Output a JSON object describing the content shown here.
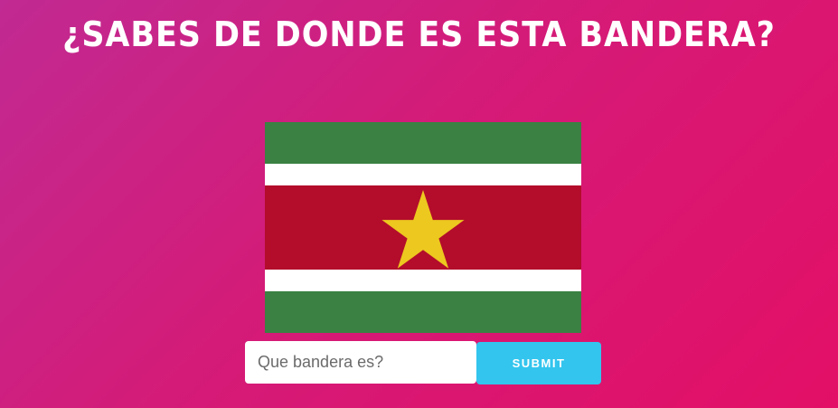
{
  "header": {
    "title": "¿SABES DE DONDE ES ESTA BANDERA?"
  },
  "flag": {
    "icon": "suriname-flag",
    "colors": {
      "green": "#3a8143",
      "white": "#ffffff",
      "red": "#b30d2b",
      "star": "#edc81f"
    }
  },
  "form": {
    "input_placeholder": "Que bandera es?",
    "input_value": "",
    "submit_label": "SUBMIT"
  },
  "theme": {
    "gradient_start": "#c12a92",
    "gradient_end": "#e30f66",
    "button_color": "#33c5ee"
  }
}
